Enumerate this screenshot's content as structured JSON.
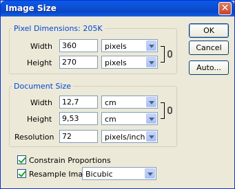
{
  "window": {
    "title": "Image Size",
    "close_glyph": "✕"
  },
  "pixel_dimensions": {
    "legend": "Pixel Dimensions: 205K",
    "width": {
      "label": "Width",
      "value": "360",
      "unit": "pixels"
    },
    "height": {
      "label": "Height",
      "value": "270",
      "unit": "pixels"
    }
  },
  "document_size": {
    "legend": "Document Size",
    "width": {
      "label": "Width",
      "value": "12,7",
      "unit": "cm"
    },
    "height": {
      "label": "Height",
      "value": "9,53",
      "unit": "cm"
    },
    "resolution": {
      "label": "Resolution",
      "value": "72",
      "unit": "pixels/inch"
    }
  },
  "options": {
    "constrain_proportions": {
      "label": "Constrain Proportions",
      "checked": true
    },
    "resample_image": {
      "label": "Resample Image:",
      "checked": true,
      "method": "Bicubic"
    }
  },
  "buttons": {
    "ok": "OK",
    "cancel": "Cancel",
    "auto": "Auto..."
  },
  "colors": {
    "title_bar": "#0c4fd3",
    "legend_text": "#0046d5",
    "dialog_bg": "#ece9d8"
  },
  "icons": [
    "close-icon",
    "link-chain-icon",
    "dropdown-arrow-icon",
    "checkmark-icon"
  ]
}
